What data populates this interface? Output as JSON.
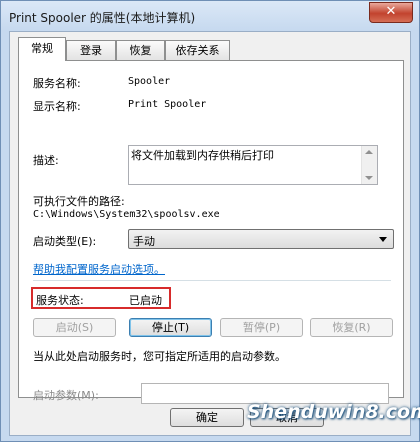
{
  "window": {
    "title": "Print Spooler 的属性(本地计算机)",
    "close_glyph": "✕"
  },
  "tabs": [
    {
      "label": "常规",
      "active": true
    },
    {
      "label": "登录",
      "active": false
    },
    {
      "label": "恢复",
      "active": false
    },
    {
      "label": "依存关系",
      "active": false
    }
  ],
  "general": {
    "service_name_label": "服务名称:",
    "service_name": "Spooler",
    "display_name_label": "显示名称:",
    "display_name": "Print Spooler",
    "description_label": "描述:",
    "description": "将文件加载到内存供稍后打印",
    "exe_path_label": "可执行文件的路径:",
    "exe_path": "C:\\Windows\\System32\\spoolsv.exe",
    "startup_type_label": "启动类型(E):",
    "startup_type": "手动",
    "help_link": "帮助我配置服务启动选项。",
    "status_label": "服务状态:",
    "status_value": "已启动",
    "buttons": {
      "start": "启动(S)",
      "stop": "停止(T)",
      "pause": "暂停(P)",
      "resume": "恢复(R)"
    },
    "hint": "当从此处启动服务时，您可指定所适用的启动参数。",
    "params_label": "启动参数(M):",
    "params_value": ""
  },
  "footer": {
    "ok": "确定",
    "cancel": "取消"
  },
  "watermark": "Shenduwin8.com",
  "colors": {
    "status_highlight": "#d72b2b",
    "link": "#0066cc"
  }
}
